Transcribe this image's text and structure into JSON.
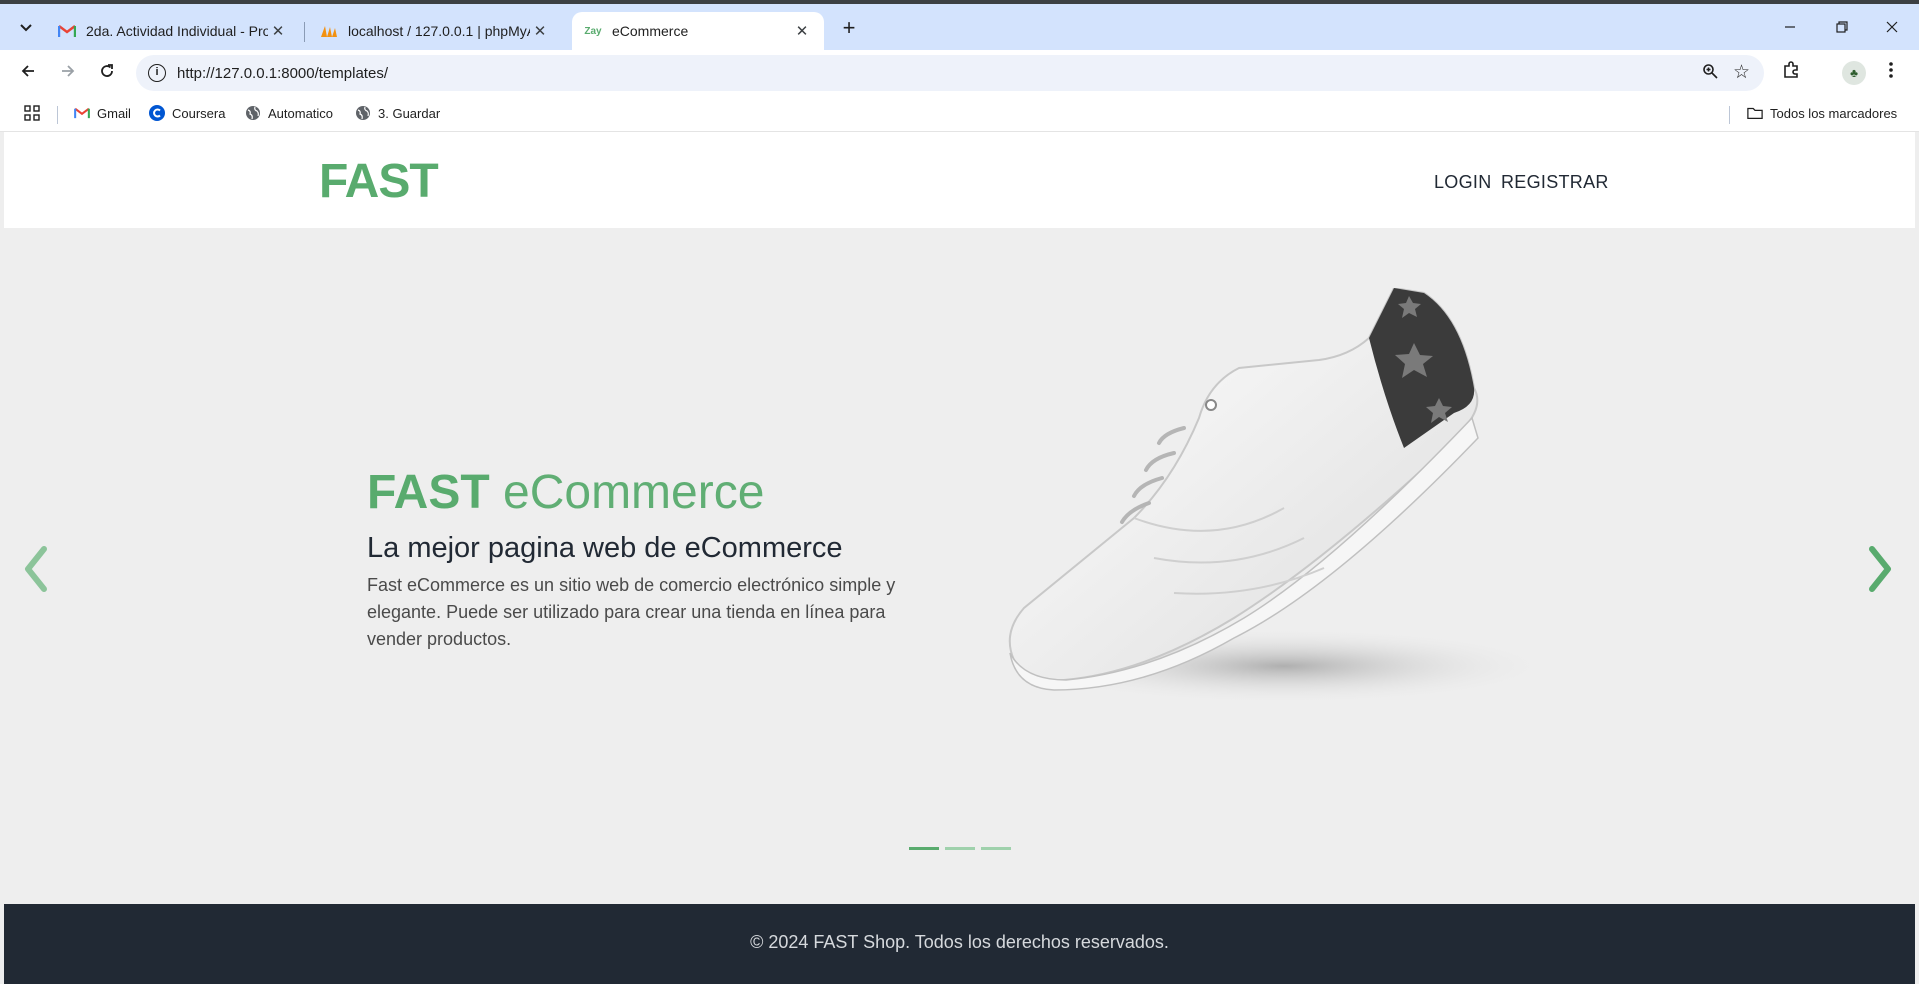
{
  "browser": {
    "tabs": [
      {
        "title": "2da. Actividad Individual - Proye",
        "favicon": "gmail-icon"
      },
      {
        "title": "localhost / 127.0.0.1 | phpMyAd",
        "favicon": "phpmyadmin-icon"
      },
      {
        "title": "eCommerce",
        "favicon": "zay-icon",
        "favicon_text": "Zay"
      }
    ],
    "url": "http://127.0.0.1:8000/templates/",
    "bookmarks": [
      {
        "label": "Gmail",
        "icon": "gmail-icon"
      },
      {
        "label": "Coursera",
        "icon": "coursera-icon"
      },
      {
        "label": "Automatico",
        "icon": "globe-icon"
      },
      {
        "label": "3. Guardar",
        "icon": "globe-icon"
      }
    ],
    "all_bookmarks": "Todos los marcadores"
  },
  "site": {
    "logo": "FAST",
    "nav": {
      "login": "LOGIN",
      "register": "REGISTRAR"
    },
    "hero": {
      "title_bold": "FAST",
      "title_light": "eCommerce",
      "subtitle": "La mejor pagina web de eCommerce",
      "description": "Fast eCommerce es un sitio web de comercio electrónico simple y elegante. Puede ser utilizado para crear una tienda en línea para vender productos.",
      "slide_count": 3,
      "active_slide": 1
    },
    "footer": "© 2024 FAST Shop. Todos los derechos reservados.",
    "colors": {
      "brand": "#59ab6e",
      "dark": "#212934",
      "hero_bg": "#eeeeee"
    }
  }
}
